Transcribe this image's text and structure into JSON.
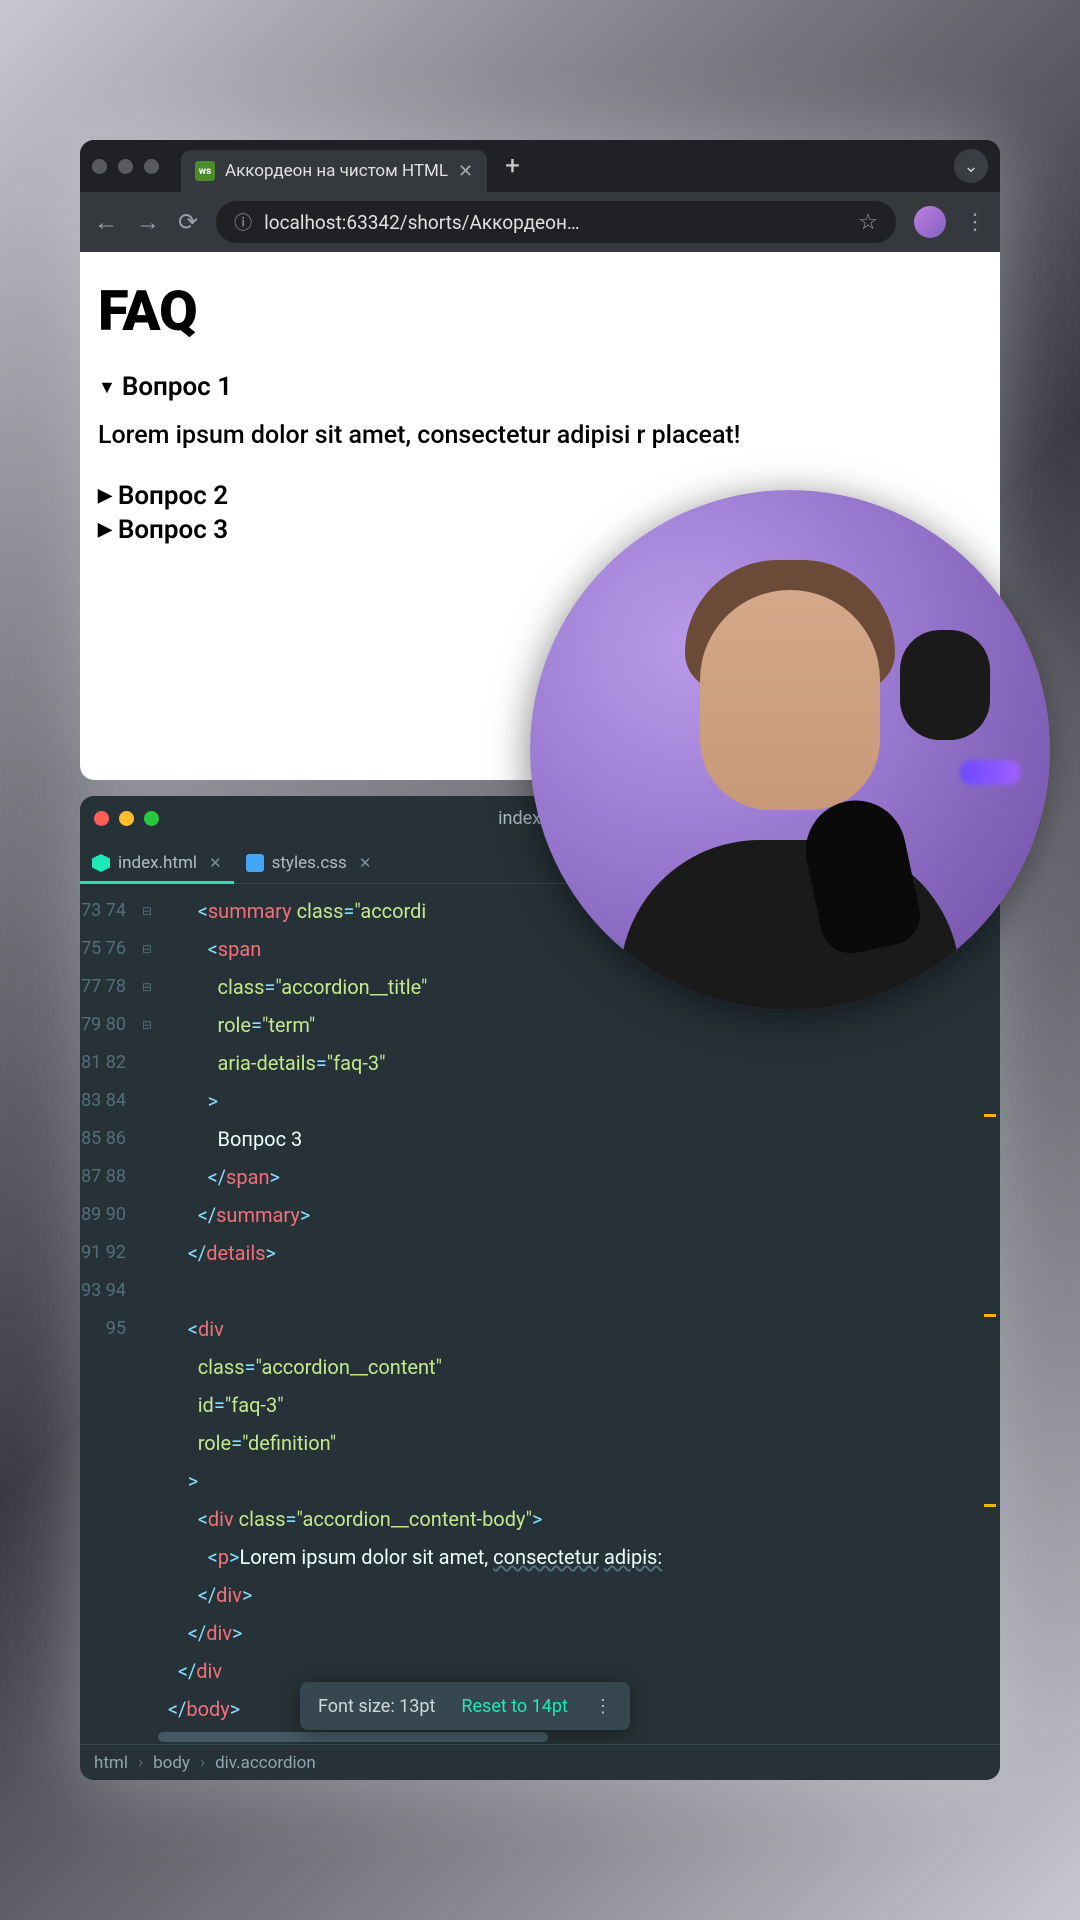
{
  "browser": {
    "tab_title": "Аккордеон на чистом HTML",
    "url": "localhost:63342/shorts/Аккордеон…",
    "new_tab_glyph": "+",
    "dropdown_glyph": "⌄"
  },
  "page": {
    "heading": "FAQ",
    "q1": "Вопрос 1",
    "q1_body": "Lorem ipsum dolor sit amet, consectetur adipisi                        r placeat!",
    "q2": "Вопрос 2",
    "q3": "Вопрос 3"
  },
  "ide": {
    "title": "index.html",
    "tab1": "index.html",
    "tab2": "styles.css",
    "gutter": [
      "73",
      "74",
      "75",
      "76",
      "77",
      "78",
      "79",
      "80",
      "81",
      "82",
      "83",
      "84",
      "85",
      "86",
      "87",
      "88",
      "89",
      "90",
      "91",
      "92",
      "93",
      "94",
      "95"
    ],
    "lines": {
      "l73": {
        "indent": "        ",
        "open": "<",
        "tag": "summary",
        "sp": " ",
        "an": "class",
        "eq": "=",
        "q": "\"",
        "av": "accordi"
      },
      "l74": {
        "indent": "          ",
        "open": "<",
        "tag": "span"
      },
      "l75": {
        "indent": "            ",
        "an": "class",
        "eq": "=",
        "q1": "\"",
        "av": "accordion__title",
        "q2": "\""
      },
      "l76": {
        "indent": "            ",
        "an": "role",
        "eq": "=",
        "q1": "\"",
        "av": "term",
        "q2": "\""
      },
      "l77": {
        "indent": "            ",
        "an": "aria-details",
        "eq": "=",
        "q1": "\"",
        "av": "faq-3",
        "q2": "\""
      },
      "l78": {
        "indent": "          ",
        "close": ">"
      },
      "l79": {
        "indent": "            ",
        "text": "Вопрос 3"
      },
      "l80": {
        "indent": "          ",
        "open": "</",
        "tag": "span",
        "close": ">"
      },
      "l81": {
        "indent": "        ",
        "open": "</",
        "tag": "summary",
        "close": ">"
      },
      "l82": {
        "indent": "      ",
        "open": "</",
        "tag": "details",
        "close": ">"
      },
      "l84": {
        "indent": "      ",
        "open": "<",
        "tag": "div"
      },
      "l85": {
        "indent": "        ",
        "an": "class",
        "eq": "=",
        "q1": "\"",
        "av": "accordion__content",
        "q2": "\""
      },
      "l86": {
        "indent": "        ",
        "an": "id",
        "eq": "=",
        "q1": "\"",
        "av": "faq-3",
        "q2": "\""
      },
      "l87": {
        "indent": "        ",
        "an": "role",
        "eq": "=",
        "q1": "\"",
        "av": "definition",
        "q2": "\""
      },
      "l88": {
        "indent": "      ",
        "close": ">"
      },
      "l89": {
        "indent": "        ",
        "open": "<",
        "tag": "div",
        "sp": " ",
        "an": "class",
        "eq": "=",
        "q1": "\"",
        "av": "accordion__content-body",
        "q2": "\"",
        "close": ">"
      },
      "l90": {
        "indent": "          ",
        "open": "<",
        "tag": "p",
        "close": ">",
        "t1": "Lorem ipsum dolor sit amet, ",
        "t2": "consectetur",
        "t3": " ",
        "t4": "adipis:"
      },
      "l91": {
        "indent": "        ",
        "open": "</",
        "tag": "div",
        "close": ">"
      },
      "l92": {
        "indent": "      ",
        "open": "</",
        "tag": "div",
        "close": ">"
      },
      "l93": {
        "indent": "    ",
        "open": "</",
        "tag": "div"
      },
      "l94": {
        "indent": "  ",
        "open": "</",
        "tag": "body",
        "close": ">"
      }
    },
    "toast_label": "Font size: 13pt",
    "toast_reset": "Reset to 14pt",
    "breadcrumb": [
      "html",
      "body",
      "div.accordion"
    ]
  }
}
